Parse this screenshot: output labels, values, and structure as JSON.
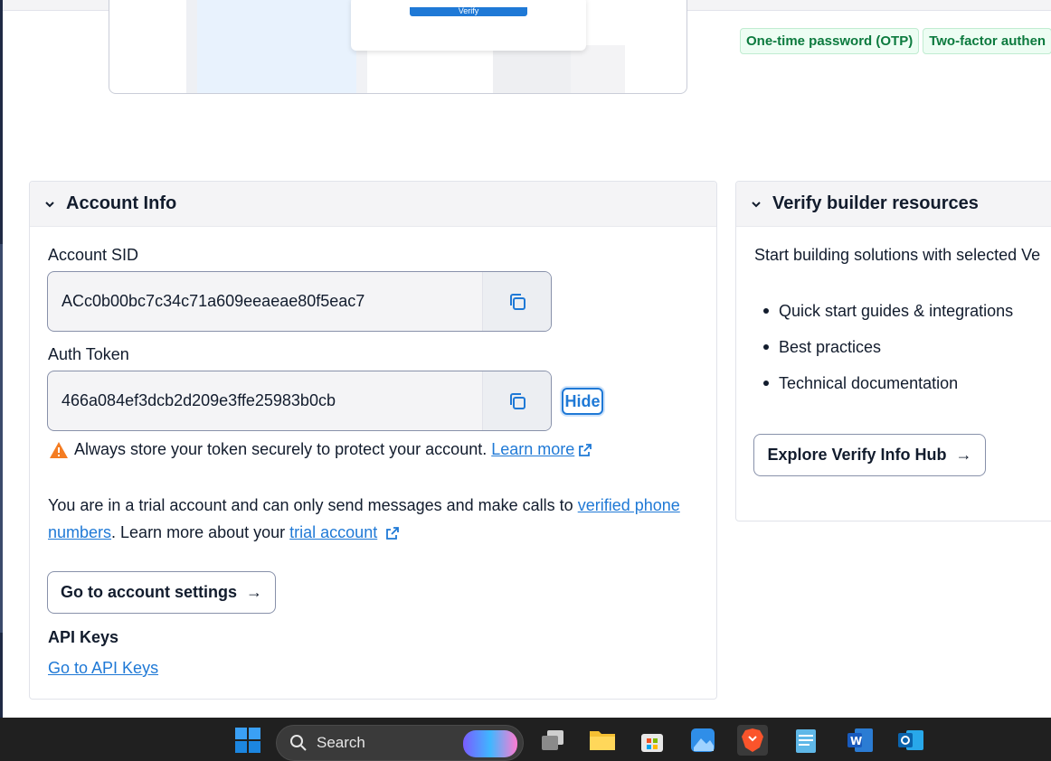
{
  "hero": {
    "verify_label": "Verify"
  },
  "tags": [
    "One-time password (OTP)",
    "Two-factor authen"
  ],
  "account": {
    "title": "Account Info",
    "sid_label": "Account SID",
    "sid_value": "ACc0b00bc7c34c71a609eeaeae80f5eac7",
    "token_label": "Auth Token",
    "token_value": "466a084ef3dcb2d209e3ffe25983b0cb",
    "hide_label": "Hide",
    "warning_text": "Always store your token securely to protect your account.",
    "warning_link": "Learn more",
    "trial_text_1": "You are in a trial account and can only send messages and make calls to ",
    "trial_link_1": "verified phone numbers",
    "trial_text_2": ". Learn more about your ",
    "trial_link_2": "trial account",
    "settings_button": "Go to account settings",
    "api_title": "API Keys",
    "api_link": "Go to API Keys"
  },
  "resources": {
    "title": "Verify builder resources",
    "description": "Start building solutions with selected Ve",
    "items": [
      "Quick start guides & integrations",
      "Best practices",
      "Technical documentation"
    ],
    "hub_button": "Explore Verify Info Hub"
  },
  "taskbar": {
    "search_label": "Search",
    "apps": [
      "start-icon",
      "task-view-icon",
      "file-explorer-icon",
      "store-icon",
      "photos-icon",
      "brave-icon",
      "notepad-icon",
      "word-icon",
      "outlook-icon"
    ]
  },
  "colors": {
    "link": "#1f79d6",
    "tag_green": "#0c7a3e",
    "warning": "#f47c22",
    "taskbar": "#202020"
  }
}
